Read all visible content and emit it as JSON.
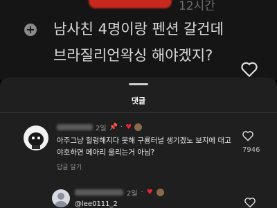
{
  "post": {
    "time": "12시간",
    "line1": "남사친 4명이랑 펜션 갈건데",
    "line2": "브라질리언왁싱 해야겠지?"
  },
  "sheet": {
    "title": "댓글"
  },
  "comments": [
    {
      "age": "2일",
      "text": "아주그냥 헐렁해지다 못해 구룡터널 생기겠노 보지에 대고 야호하면 메아리 울리는거 아님?",
      "reply_label": "답글 달기",
      "like_count": "7946"
    },
    {
      "age": "2일",
      "mention": "@lee0111_2"
    }
  ],
  "colors": {
    "heart": "#e5243b",
    "redaction": "#c8281e"
  }
}
